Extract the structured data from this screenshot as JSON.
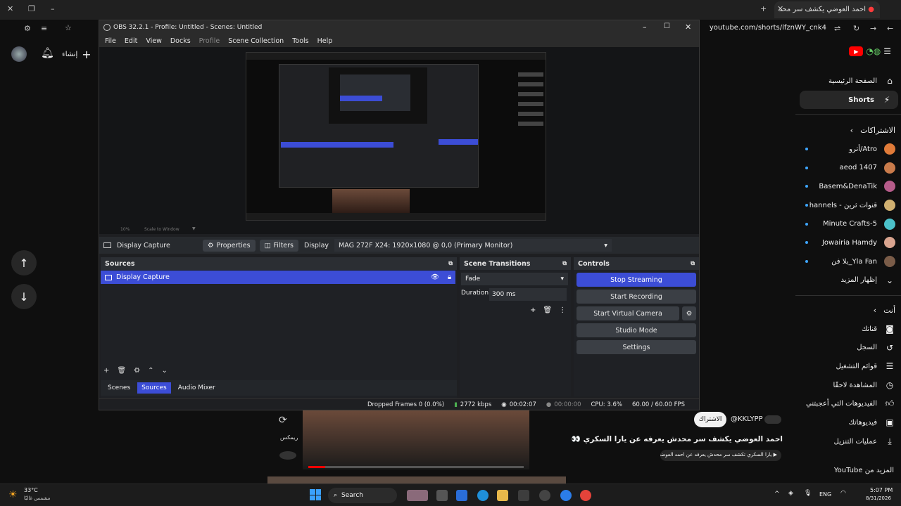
{
  "browser": {
    "tab_title": "احمد العوضي يكشف سر محد",
    "url": "youtube.com/shorts/lfznWY_cnk4",
    "create_label": "إنشاء"
  },
  "youtube_sidebar": {
    "nav": [
      {
        "label": "الصفحة الرئيسية",
        "icon": "home-icon"
      },
      {
        "label": "Shorts",
        "icon": "shorts-icon"
      }
    ],
    "subscriptions_title": "الاشتراكات",
    "subscriptions": [
      {
        "label": "Atro/أترو",
        "color": "#e07b39"
      },
      {
        "label": "aeod 1407",
        "color": "#c97b4b"
      },
      {
        "label": "Basem&DenaTik",
        "color": "#b65c8a"
      },
      {
        "label": "قنوات ثرين - hannels",
        "color": "#d0b070"
      },
      {
        "label": "5-Minute Crafts",
        "color": "#4bc1c9"
      },
      {
        "label": "Jowairia Hamdy",
        "color": "#d9a48f"
      },
      {
        "label": "Yla Fan_بلا فن",
        "color": "#7a5c48"
      }
    ],
    "show_more": "إظهار المزيد",
    "you_title": "أنت",
    "you_items": [
      {
        "label": "قناتك",
        "icon": "channel-icon"
      },
      {
        "label": "السجل",
        "icon": "history-icon"
      },
      {
        "label": "قوائم التشغيل",
        "icon": "playlist-icon"
      },
      {
        "label": "المشاهدة لاحقًا",
        "icon": "clock-icon"
      },
      {
        "label": "الفيديوهات التي أعجبتني",
        "icon": "like-icon"
      },
      {
        "label": "فيديوهاتك",
        "icon": "video-icon"
      },
      {
        "label": "عمليات التنزيل",
        "icon": "download-icon"
      }
    ],
    "more_from": "المزيد من YouTube"
  },
  "short": {
    "channel": "@KKLYPP",
    "subscribe_label": "الاشتراك",
    "title": "احمد العوضي يكشف سر محدش يعرفه عن يارا السكري 👀",
    "related": "يارا السكري تكشف سر محدش يعرفه عن احمد العوضي 👀",
    "remix_label": "ريمكس"
  },
  "obs": {
    "title": "OBS 32.2.1 - Profile: Untitled - Scenes: Untitled",
    "menu": [
      "File",
      "Edit",
      "View",
      "Docks",
      "Profile",
      "Scene Collection",
      "Tools",
      "Help"
    ],
    "scale_label": "Scale to Window",
    "zoom": "10%",
    "context": {
      "source_name": "Display Capture",
      "properties": "Properties",
      "filters": "Filters",
      "display_label": "Display",
      "display_value": "MAG 272F X24: 1920x1080 @ 0,0 (Primary Monitor)"
    },
    "sources": {
      "title": "Sources",
      "items": [
        "Display Capture"
      ]
    },
    "transitions": {
      "title": "Scene Transitions",
      "type": "Fade",
      "duration_label": "Duration",
      "duration": "300 ms"
    },
    "controls": {
      "title": "Controls",
      "buttons": [
        "Stop Streaming",
        "Start Recording",
        "Start Virtual Camera",
        "Studio Mode",
        "Settings"
      ]
    },
    "bottom_tabs": [
      "Scenes",
      "Sources",
      "Audio Mixer"
    ],
    "status": {
      "dropped": "Dropped Frames 0 (0.0%)",
      "bitrate": "2772 kbps",
      "stream_time": "00:02:07",
      "rec_time": "00:00:00",
      "cpu": "CPU: 3.6%",
      "fps": "60.00 / 60.00 FPS"
    }
  },
  "taskbar": {
    "weather_temp": "33°C",
    "weather_desc": "مشمس غالبًا",
    "search": "Search",
    "lang": "ENG",
    "time": "5:07 PM",
    "date": "8/31/2026"
  },
  "colors": {
    "obs_accent": "#3c4dd6",
    "yt_red": "#ff0000"
  }
}
